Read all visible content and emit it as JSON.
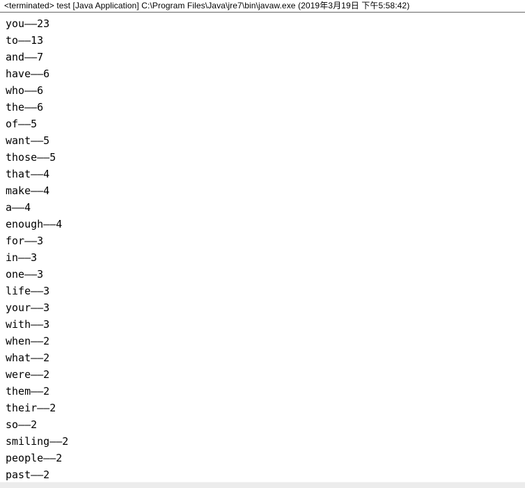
{
  "window": {
    "view_name": "Console"
  },
  "header": {
    "status": "<terminated>",
    "launch_name": "test",
    "launch_type": "[Java Application]",
    "executable_path": "C:\\Program Files\\Java\\jre7\\bin\\javaw.exe",
    "timestamp": "(2019年3月19日 下午5:58:42)",
    "full_text": "<terminated> test [Java Application] C:\\Program Files\\Java\\jre7\\bin\\javaw.exe (2019年3月19日 下午5:58:42)"
  },
  "colors": {
    "background": "#ffffff",
    "text": "#000000",
    "divider": "#6d6d6d",
    "scrollbar_trough": "#ececec"
  },
  "output": {
    "separator": "——",
    "lines": [
      "you——23",
      "to——13",
      "and——7",
      "have——6",
      "who——6",
      "the——6",
      "of——5",
      "want——5",
      "those——5",
      "that——4",
      "make——4",
      "a——4",
      "enough——4",
      "for——3",
      "in——3",
      "one——3",
      "life——3",
      "your——3",
      "with——3",
      "when——2",
      "what——2",
      "were——2",
      "them——2",
      "their——2",
      "so——2",
      "smiling——2",
      "people——2",
      "past——2"
    ],
    "entries": [
      {
        "word": "you",
        "count": 23
      },
      {
        "word": "to",
        "count": 13
      },
      {
        "word": "and",
        "count": 7
      },
      {
        "word": "have",
        "count": 6
      },
      {
        "word": "who",
        "count": 6
      },
      {
        "word": "the",
        "count": 6
      },
      {
        "word": "of",
        "count": 5
      },
      {
        "word": "want",
        "count": 5
      },
      {
        "word": "those",
        "count": 5
      },
      {
        "word": "that",
        "count": 4
      },
      {
        "word": "make",
        "count": 4
      },
      {
        "word": "a",
        "count": 4
      },
      {
        "word": "enough",
        "count": 4
      },
      {
        "word": "for",
        "count": 3
      },
      {
        "word": "in",
        "count": 3
      },
      {
        "word": "one",
        "count": 3
      },
      {
        "word": "life",
        "count": 3
      },
      {
        "word": "your",
        "count": 3
      },
      {
        "word": "with",
        "count": 3
      },
      {
        "word": "when",
        "count": 2
      },
      {
        "word": "what",
        "count": 2
      },
      {
        "word": "were",
        "count": 2
      },
      {
        "word": "them",
        "count": 2
      },
      {
        "word": "their",
        "count": 2
      },
      {
        "word": "so",
        "count": 2
      },
      {
        "word": "smiling",
        "count": 2
      },
      {
        "word": "people",
        "count": 2
      },
      {
        "word": "past",
        "count": 2
      }
    ]
  }
}
